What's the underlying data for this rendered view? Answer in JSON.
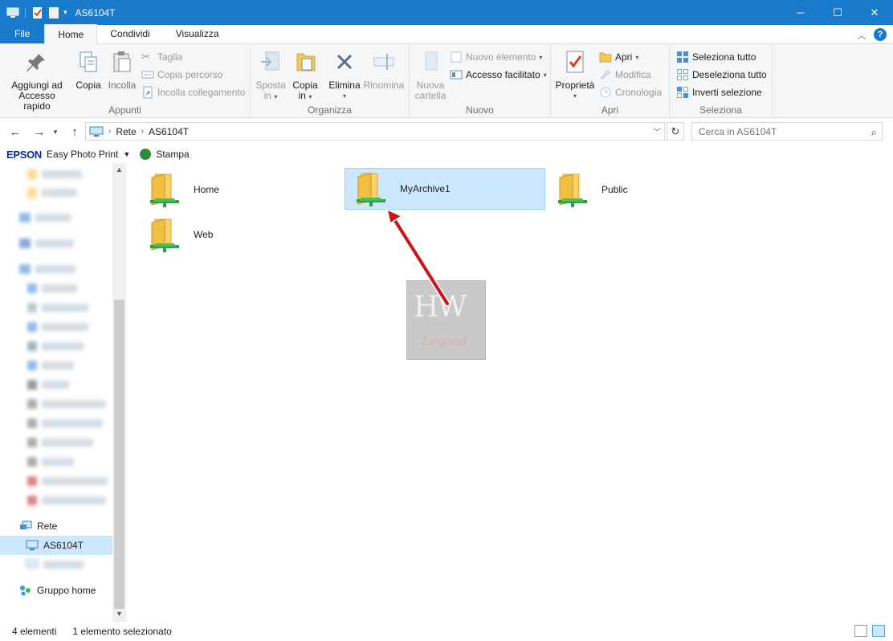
{
  "window": {
    "title": "AS6104T",
    "accent": "#1979ca"
  },
  "ribbon": {
    "tabs": [
      "File",
      "Home",
      "Condividi",
      "Visualizza"
    ],
    "groups": {
      "appunti": {
        "label": "Appunti",
        "pin_label_1": "Aggiungi ad",
        "pin_label_2": "Accesso rapido",
        "copy_label": "Copia",
        "paste_label": "Incolla",
        "cut_label": "Taglia",
        "copy_path_label": "Copia percorso",
        "paste_shortcut_label": "Incolla collegamento"
      },
      "organizza": {
        "label": "Organizza",
        "move_label_1": "Sposta",
        "move_label_2": "in",
        "copyto_label_1": "Copia",
        "copyto_label_2": "in",
        "delete_label": "Elimina",
        "rename_label": "Rinomina"
      },
      "nuovo": {
        "label": "Nuovo",
        "new_folder_label_1": "Nuova",
        "new_folder_label_2": "cartella",
        "new_item_label": "Nuovo elemento",
        "easy_access_label": "Accesso facilitato"
      },
      "apri": {
        "label": "Apri",
        "properties_label": "Proprietà",
        "open_label": "Apri",
        "edit_label": "Modifica",
        "history_label": "Cronologia"
      },
      "seleziona": {
        "label": "Seleziona",
        "select_all_label": "Seleziona tutto",
        "select_none_label": "Deseleziona tutto",
        "invert_label": "Inverti selezione"
      }
    }
  },
  "address": {
    "crumbs": [
      "Rete",
      "AS6104T"
    ],
    "search_placeholder": "Cerca in AS6104T"
  },
  "epson": {
    "logo": "EPSON",
    "easy_photo_print": "Easy Photo Print",
    "print": "Stampa"
  },
  "navpane": {
    "network_label": "Rete",
    "selected_label": "AS6104T",
    "homegroup_label": "Gruppo home"
  },
  "content": {
    "items": [
      {
        "name": "Home",
        "selected": false
      },
      {
        "name": "MyArchive1",
        "selected": true
      },
      {
        "name": "Public",
        "selected": false
      },
      {
        "name": "Web",
        "selected": false
      }
    ]
  },
  "watermark": {
    "text_top": "HW",
    "text_bottom": "Legend"
  },
  "status": {
    "count": "4 elementi",
    "selection": "1 elemento selezionato"
  }
}
